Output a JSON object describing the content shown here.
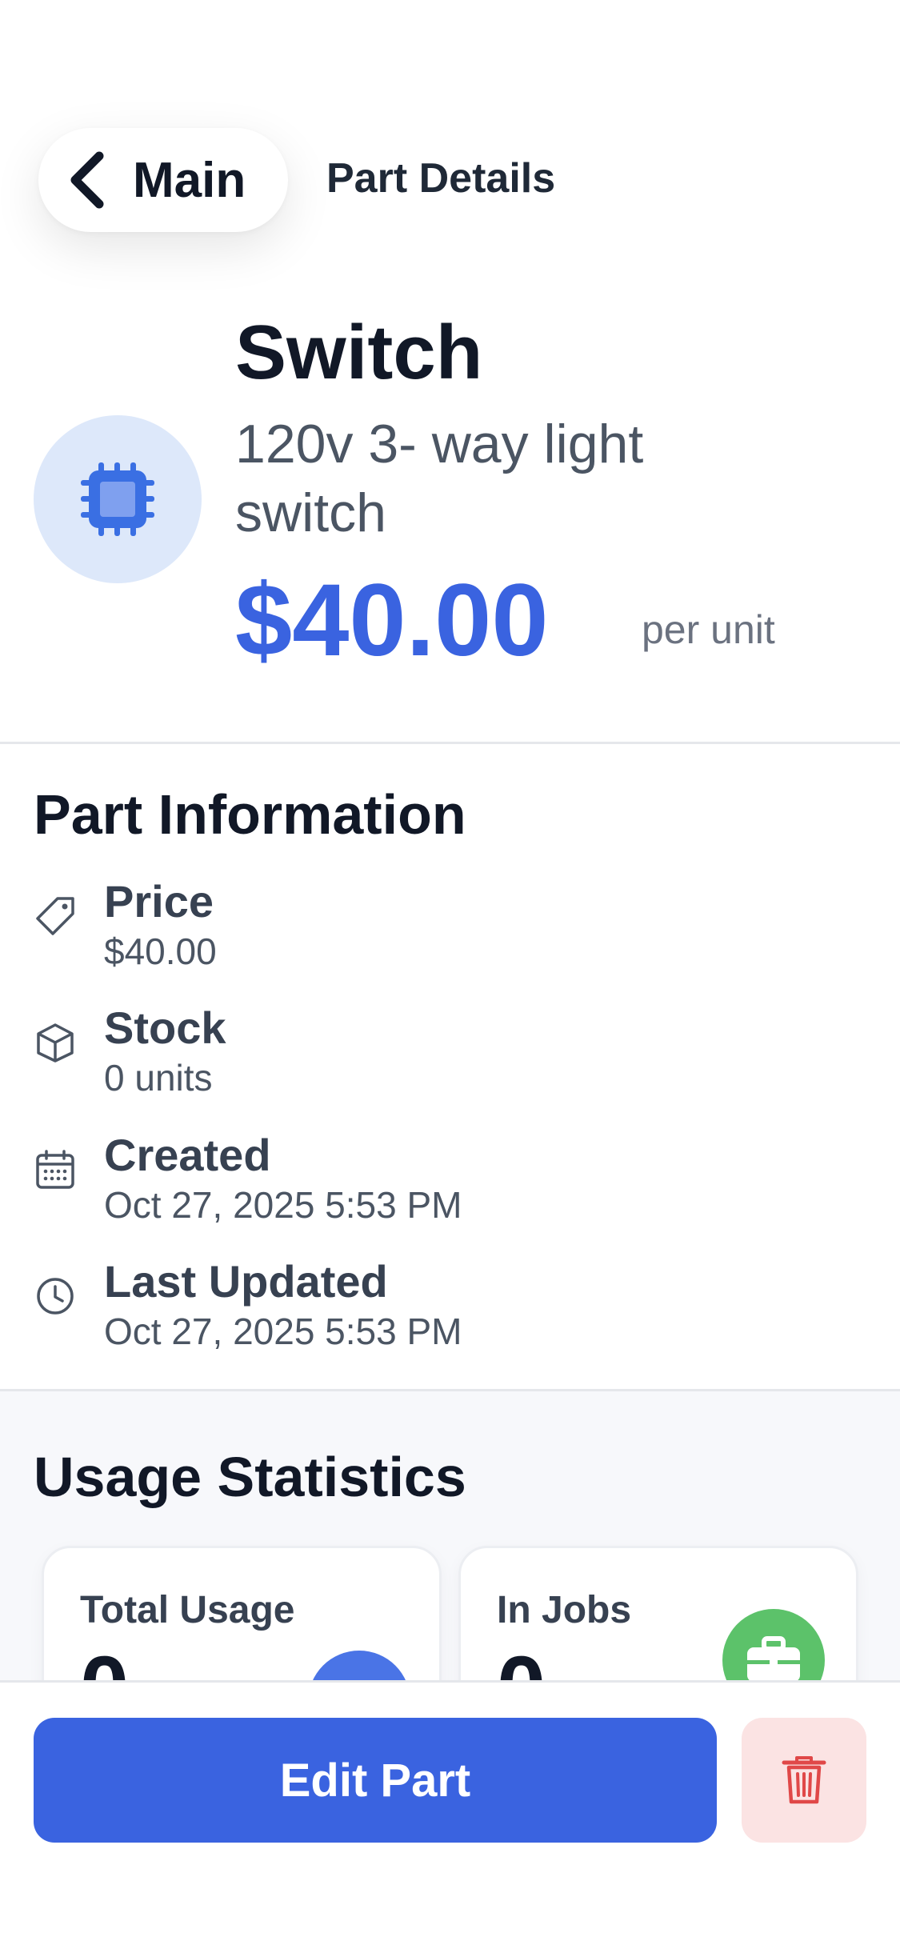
{
  "header": {
    "back_label": "Main",
    "title": "Part Details"
  },
  "part": {
    "icon": "chip-icon",
    "name": "Switch",
    "description": "120v 3- way light switch",
    "price": "$40.00",
    "price_unit": "per unit"
  },
  "info_section": {
    "title": "Part Information",
    "rows": [
      {
        "icon": "tag-icon",
        "label": "Price",
        "value": "$40.00"
      },
      {
        "icon": "box-icon",
        "label": "Stock",
        "value": "0 units"
      },
      {
        "icon": "calendar-icon",
        "label": "Created",
        "value": "Oct 27, 2025 5:53 PM"
      },
      {
        "icon": "clock-icon",
        "label": "Last Updated",
        "value": "Oct 27, 2025 5:53 PM"
      }
    ]
  },
  "usage_section": {
    "title": "Usage Statistics",
    "cards": [
      {
        "label": "Total Usage",
        "value": "0",
        "icon": "chart-icon",
        "color": "#4a74e6"
      },
      {
        "label": "In Jobs",
        "value": "0",
        "icon": "briefcase-icon",
        "color": "#5cc26a"
      }
    ]
  },
  "actions": {
    "edit_label": "Edit Part",
    "delete_icon": "trash-icon"
  },
  "colors": {
    "accent": "#3a63e0",
    "danger": "#e04848",
    "danger_bg": "#fbe3e3"
  }
}
